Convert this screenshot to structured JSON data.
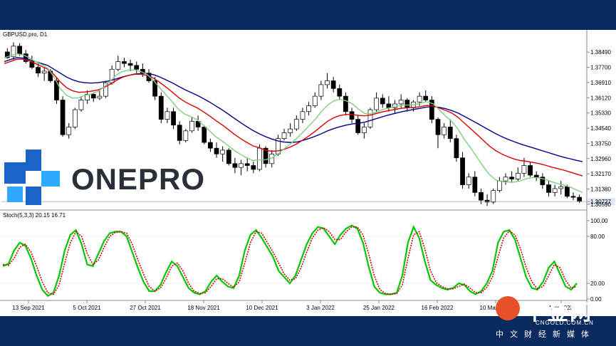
{
  "chart_data": [
    {
      "type": "line",
      "subtype": "candlestick",
      "title": "GBPUSD.pro, D1",
      "y_tick_labels": [
        "1.38490",
        "1.37700",
        "1.36910",
        "1.36120",
        "1.35330",
        "1.34540",
        "1.33750",
        "1.32960",
        "1.32170",
        "1.31380",
        "1.30727",
        "1.30590"
      ],
      "current_price": "1.30727",
      "ylim": [
        1.304,
        1.392
      ],
      "grid": false,
      "candles": [
        [
          1.385,
          1.387,
          1.3815,
          1.382
        ],
        [
          1.3825,
          1.39,
          1.381,
          1.388
        ],
        [
          1.388,
          1.3895,
          1.383,
          1.384
        ],
        [
          1.384,
          1.386,
          1.379,
          1.38
        ],
        [
          1.38,
          1.383,
          1.376,
          1.377
        ],
        [
          1.377,
          1.379,
          1.372,
          1.374
        ],
        [
          1.374,
          1.377,
          1.37,
          1.375
        ],
        [
          1.375,
          1.376,
          1.369,
          1.37
        ],
        [
          1.37,
          1.372,
          1.358,
          1.36
        ],
        [
          1.36,
          1.362,
          1.341,
          1.342
        ],
        [
          1.342,
          1.348,
          1.34,
          1.346
        ],
        [
          1.346,
          1.356,
          1.345,
          1.355
        ],
        [
          1.355,
          1.362,
          1.354,
          1.36
        ],
        [
          1.36,
          1.365,
          1.358,
          1.363
        ],
        [
          1.363,
          1.364,
          1.359,
          1.361
        ],
        [
          1.361,
          1.365,
          1.36,
          1.362
        ],
        [
          1.362,
          1.37,
          1.361,
          1.369
        ],
        [
          1.369,
          1.378,
          1.368,
          1.376
        ],
        [
          1.376,
          1.383,
          1.375,
          1.38
        ],
        [
          1.38,
          1.382,
          1.377,
          1.379
        ],
        [
          1.379,
          1.381,
          1.375,
          1.378
        ],
        [
          1.378,
          1.38,
          1.374,
          1.376
        ],
        [
          1.376,
          1.379,
          1.372,
          1.374
        ],
        [
          1.374,
          1.376,
          1.369,
          1.37
        ],
        [
          1.37,
          1.372,
          1.36,
          1.362
        ],
        [
          1.362,
          1.364,
          1.348,
          1.35
        ],
        [
          1.35,
          1.356,
          1.348,
          1.354
        ],
        [
          1.354,
          1.356,
          1.345,
          1.347
        ],
        [
          1.347,
          1.349,
          1.337,
          1.339
        ],
        [
          1.339,
          1.345,
          1.338,
          1.344
        ],
        [
          1.344,
          1.351,
          1.343,
          1.349
        ],
        [
          1.349,
          1.352,
          1.344,
          1.346
        ],
        [
          1.346,
          1.347,
          1.337,
          1.338
        ],
        [
          1.338,
          1.34,
          1.333,
          1.335
        ],
        [
          1.335,
          1.338,
          1.33,
          1.332
        ],
        [
          1.332,
          1.336,
          1.328,
          1.334
        ],
        [
          1.334,
          1.335,
          1.326,
          1.327
        ],
        [
          1.327,
          1.33,
          1.322,
          1.325
        ],
        [
          1.325,
          1.329,
          1.321,
          1.327
        ],
        [
          1.327,
          1.33,
          1.323,
          1.326
        ],
        [
          1.326,
          1.328,
          1.322,
          1.324
        ],
        [
          1.324,
          1.337,
          1.323,
          1.335
        ],
        [
          1.335,
          1.336,
          1.325,
          1.327
        ],
        [
          1.327,
          1.334,
          1.325,
          1.332
        ],
        [
          1.332,
          1.342,
          1.331,
          1.34
        ],
        [
          1.34,
          1.345,
          1.339,
          1.343
        ],
        [
          1.343,
          1.348,
          1.341,
          1.345
        ],
        [
          1.345,
          1.352,
          1.344,
          1.35
        ],
        [
          1.35,
          1.356,
          1.348,
          1.354
        ],
        [
          1.354,
          1.359,
          1.352,
          1.357
        ],
        [
          1.357,
          1.364,
          1.356,
          1.362
        ],
        [
          1.362,
          1.37,
          1.36,
          1.368
        ],
        [
          1.368,
          1.374,
          1.366,
          1.37
        ],
        [
          1.37,
          1.372,
          1.364,
          1.366
        ],
        [
          1.366,
          1.368,
          1.36,
          1.362
        ],
        [
          1.362,
          1.364,
          1.352,
          1.354
        ],
        [
          1.354,
          1.356,
          1.348,
          1.35
        ],
        [
          1.35,
          1.352,
          1.342,
          1.343
        ],
        [
          1.343,
          1.348,
          1.34,
          1.346
        ],
        [
          1.346,
          1.356,
          1.345,
          1.355
        ],
        [
          1.355,
          1.364,
          1.354,
          1.361
        ],
        [
          1.361,
          1.363,
          1.356,
          1.358
        ],
        [
          1.358,
          1.362,
          1.354,
          1.356
        ],
        [
          1.356,
          1.36,
          1.353,
          1.358
        ],
        [
          1.358,
          1.363,
          1.356,
          1.36
        ],
        [
          1.36,
          1.361,
          1.354,
          1.356
        ],
        [
          1.356,
          1.36,
          1.354,
          1.359
        ],
        [
          1.359,
          1.364,
          1.357,
          1.362
        ],
        [
          1.362,
          1.365,
          1.359,
          1.36
        ],
        [
          1.36,
          1.362,
          1.348,
          1.35
        ],
        [
          1.35,
          1.351,
          1.335,
          1.342
        ],
        [
          1.342,
          1.348,
          1.34,
          1.346
        ],
        [
          1.346,
          1.35,
          1.338,
          1.34
        ],
        [
          1.34,
          1.342,
          1.328,
          1.33
        ],
        [
          1.33,
          1.333,
          1.314,
          1.316
        ],
        [
          1.316,
          1.322,
          1.314,
          1.32
        ],
        [
          1.32,
          1.323,
          1.31,
          1.312
        ],
        [
          1.312,
          1.314,
          1.306,
          1.308
        ],
        [
          1.308,
          1.311,
          1.305,
          1.307
        ],
        [
          1.307,
          1.314,
          1.306,
          1.313
        ],
        [
          1.313,
          1.32,
          1.312,
          1.318
        ],
        [
          1.318,
          1.322,
          1.316,
          1.32
        ],
        [
          1.32,
          1.323,
          1.317,
          1.319
        ],
        [
          1.319,
          1.325,
          1.318,
          1.322
        ],
        [
          1.322,
          1.33,
          1.32,
          1.326
        ],
        [
          1.326,
          1.328,
          1.32,
          1.321
        ],
        [
          1.321,
          1.323,
          1.318,
          1.32
        ],
        [
          1.32,
          1.322,
          1.314,
          1.316
        ],
        [
          1.316,
          1.318,
          1.31,
          1.312
        ],
        [
          1.312,
          1.316,
          1.31,
          1.314
        ],
        [
          1.314,
          1.318,
          1.311,
          1.315
        ],
        [
          1.315,
          1.316,
          1.309,
          1.31
        ],
        [
          1.31,
          1.312,
          1.308,
          1.3095
        ],
        [
          1.3095,
          1.311,
          1.3065,
          1.3073
        ]
      ],
      "series": [
        {
          "name": "",
          "color": "#00008b",
          "values": [
            1.38,
            1.381,
            1.382,
            1.3818,
            1.381,
            1.38,
            1.379,
            1.378,
            1.376,
            1.374,
            1.372,
            1.3705,
            1.3695,
            1.369,
            1.3688,
            1.369,
            1.3695,
            1.37,
            1.371,
            1.372,
            1.3728,
            1.3735,
            1.3738,
            1.3738,
            1.3732,
            1.372,
            1.3705,
            1.369,
            1.3672,
            1.3655,
            1.364,
            1.3625,
            1.3608,
            1.359,
            1.357,
            1.355,
            1.3528,
            1.3505,
            1.3483,
            1.3462,
            1.3442,
            1.3425,
            1.341,
            1.3398,
            1.3388,
            1.3382,
            1.338,
            1.3382,
            1.339,
            1.34,
            1.3412,
            1.3425,
            1.344,
            1.3452,
            1.3462,
            1.347,
            1.3476,
            1.348,
            1.3485,
            1.3495,
            1.3505,
            1.3515,
            1.3524,
            1.3532,
            1.354,
            1.3546,
            1.3552,
            1.3558,
            1.3564,
            1.3566,
            1.3562,
            1.3555,
            1.3545,
            1.3532,
            1.3515,
            1.3498,
            1.348,
            1.3462,
            1.3444,
            1.3426,
            1.341,
            1.3396,
            1.3384,
            1.3372,
            1.3362,
            1.3352,
            1.3342,
            1.3332,
            1.3322,
            1.3312,
            1.3303,
            1.3295,
            1.3287,
            1.328
          ]
        },
        {
          "name": "",
          "color": "#dd0000",
          "values": [
            1.379,
            1.38,
            1.3812,
            1.3812,
            1.3804,
            1.379,
            1.3775,
            1.376,
            1.3732,
            1.3695,
            1.3665,
            1.3648,
            1.364,
            1.3642,
            1.3646,
            1.3652,
            1.3664,
            1.3682,
            1.3702,
            1.3718,
            1.3728,
            1.3734,
            1.3734,
            1.3728,
            1.3714,
            1.3692,
            1.3668,
            1.3642,
            1.3614,
            1.3592,
            1.3575,
            1.356,
            1.354,
            1.3518,
            1.3494,
            1.3472,
            1.3448,
            1.3422,
            1.34,
            1.338,
            1.3362,
            1.3352,
            1.334,
            1.3334,
            1.3336,
            1.3344,
            1.3356,
            1.3372,
            1.3392,
            1.3414,
            1.3438,
            1.3464,
            1.349,
            1.3508,
            1.352,
            1.3525,
            1.3525,
            1.352,
            1.3518,
            1.3522,
            1.3532,
            1.354,
            1.3546,
            1.3552,
            1.3558,
            1.356,
            1.3562,
            1.3566,
            1.3572,
            1.357,
            1.3558,
            1.3546,
            1.3532,
            1.351,
            1.348,
            1.3452,
            1.3422,
            1.3392,
            1.3362,
            1.3338,
            1.332,
            1.3306,
            1.3294,
            1.3286,
            1.3282,
            1.3276,
            1.327,
            1.3262,
            1.3252,
            1.3244,
            1.3236,
            1.3226,
            1.3216,
            1.3206
          ]
        },
        {
          "name": "",
          "color": "#7fcf7f",
          "values": [
            1.382,
            1.383,
            1.384,
            1.3835,
            1.382,
            1.38,
            1.3785,
            1.3765,
            1.372,
            1.366,
            1.3625,
            1.361,
            1.3612,
            1.3625,
            1.3632,
            1.3644,
            1.3666,
            1.3698,
            1.373,
            1.3748,
            1.3756,
            1.3756,
            1.3748,
            1.3732,
            1.3702,
            1.3664,
            1.3628,
            1.3592,
            1.3552,
            1.3528,
            1.3514,
            1.3498,
            1.347,
            1.344,
            1.341,
            1.3388,
            1.3364,
            1.3338,
            1.3318,
            1.33,
            1.3286,
            1.329,
            1.329,
            1.3298,
            1.332,
            1.3346,
            1.3372,
            1.34,
            1.3432,
            1.3466,
            1.35,
            1.354,
            1.3574,
            1.3596,
            1.3604,
            1.3596,
            1.358,
            1.3552,
            1.353,
            1.3528,
            1.354,
            1.3552,
            1.356,
            1.3566,
            1.3574,
            1.3574,
            1.3576,
            1.3584,
            1.3592,
            1.358,
            1.3548,
            1.3516,
            1.3488,
            1.3448,
            1.3396,
            1.3352,
            1.3304,
            1.3256,
            1.3214,
            1.3186,
            1.3176,
            1.3174,
            1.3174,
            1.318,
            1.3192,
            1.3198,
            1.3196,
            1.3188,
            1.3176,
            1.3166,
            1.3158,
            1.3148,
            1.3134,
            1.312
          ]
        }
      ]
    },
    {
      "type": "line",
      "title": "Stoch(5,3,3) 20.15 16.71",
      "ylim": [
        0,
        100
      ],
      "y_tick_labels": [
        "100.00",
        "80.00",
        "20.00",
        "0.00"
      ],
      "series": [
        {
          "name": "",
          "color": "#00c800",
          "values": [
            42,
            45,
            62,
            72,
            68,
            52,
            30,
            12,
            4,
            8,
            30,
            62,
            82,
            88,
            70,
            44,
            42,
            58,
            74,
            84,
            86,
            86,
            80,
            60,
            40,
            22,
            10,
            10,
            18,
            34,
            48,
            42,
            28,
            14,
            8,
            6,
            10,
            22,
            30,
            22,
            16,
            14,
            30,
            62,
            82,
            88,
            78,
            66,
            54,
            36,
            28,
            20,
            30,
            50,
            70,
            84,
            92,
            90,
            80,
            70,
            82,
            90,
            94,
            90,
            72,
            42,
            16,
            8,
            6,
            6,
            8,
            30,
            72,
            92,
            78,
            48,
            24,
            18,
            14,
            12,
            14,
            20,
            18,
            10,
            6,
            10,
            20,
            36,
            72,
            86,
            88,
            76,
            52,
            28,
            14,
            12,
            22,
            40,
            48,
            32,
            16,
            12,
            20
          ]
        },
        {
          "name": "",
          "color": "#cc0000",
          "values": [
            44,
            43,
            52,
            66,
            70,
            60,
            42,
            22,
            8,
            6,
            18,
            46,
            72,
            86,
            80,
            58,
            44,
            50,
            66,
            80,
            85,
            86,
            84,
            70,
            50,
            32,
            16,
            10,
            14,
            26,
            42,
            46,
            36,
            20,
            10,
            7,
            8,
            16,
            26,
            26,
            20,
            15,
            22,
            46,
            72,
            86,
            84,
            72,
            60,
            46,
            32,
            24,
            26,
            40,
            60,
            78,
            88,
            91,
            86,
            76,
            76,
            86,
            92,
            92,
            82,
            58,
            30,
            12,
            7,
            6,
            7,
            18,
            52,
            82,
            86,
            64,
            36,
            21,
            16,
            13,
            13,
            16,
            19,
            14,
            8,
            8,
            15,
            28,
            54,
            78,
            87,
            82,
            64,
            40,
            22,
            13,
            16,
            30,
            44,
            40,
            24,
            14,
            16
          ]
        }
      ]
    }
  ],
  "x_tick_labels": [
    "13 Sep 2021",
    "5 Oct 2021",
    "27 Oct 2021",
    "18 Nov 2021",
    "10 Dec 2021",
    "3 Jan 2022",
    "25 Jan 2022",
    "16 Feb 2022",
    "10 Mar 2022",
    "Mar 2022"
  ],
  "branding": {
    "onepro": "ONEPRO",
    "cngold_cn": "中金网",
    "cngold_en": "CNGOLD.COM.CN",
    "cngold_sub": "中文财经新媒体"
  }
}
